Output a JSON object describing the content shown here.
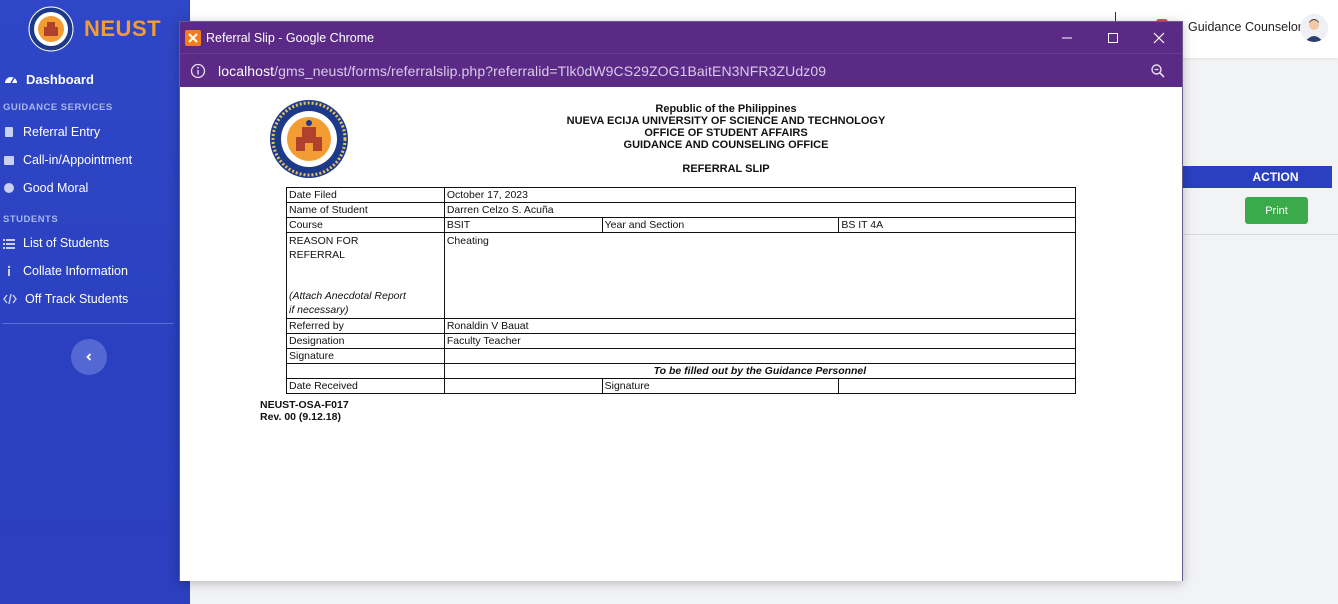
{
  "sidebar": {
    "brand": "NEUST",
    "dashboard": "Dashboard",
    "sections": [
      {
        "title": "GUIDANCE SERVICES",
        "items": [
          "Referral Entry",
          "Call-in/Appointment",
          "Good Moral"
        ]
      },
      {
        "title": "STUDENTS",
        "items": [
          "List of Students",
          "Collate Information",
          "Off Track Students"
        ]
      }
    ]
  },
  "topbar": {
    "user": "Guidance Counselor"
  },
  "table_bg": {
    "action_header": "ACTION",
    "print_label": "Print"
  },
  "browser": {
    "title": "Referral Slip - Google Chrome",
    "url_host": "localhost",
    "url_rest": "/gms_neust/forms/referralslip.php?referralid=Tlk0dW9CS29ZOG1BaitEN3NFR3ZUdz09"
  },
  "document": {
    "header_lines": [
      "Republic of the Philippines",
      "NUEVA ECIJA UNIVERSITY OF SCIENCE AND TECHNOLOGY",
      "OFFICE OF STUDENT AFFAIRS",
      "GUIDANCE AND COUNSELING OFFICE"
    ],
    "slip_title": "REFERRAL SLIP",
    "labels": {
      "date_filed": "Date Filed",
      "name": "Name of Student",
      "course": "Course",
      "year_section": "Year and Section",
      "reason_1": "REASON FOR",
      "reason_2": "REFERRAL",
      "attach_1": "(Attach Anecdotal Report",
      "attach_2": "if necessary)",
      "referred_by": "Referred by",
      "designation": "Designation",
      "signature": "Signature",
      "filled_by": "To be filled out by the Guidance Personnel",
      "date_received": "Date Received",
      "signature2": "Signature"
    },
    "values": {
      "date_filed": "October 17, 2023",
      "name": "Darren Celzo S. Acuña",
      "course": "BSIT",
      "year_section": "BS IT 4A",
      "reason": "Cheating",
      "referred_by": "Ronaldin V Bauat",
      "designation": "Faculty Teacher"
    },
    "form_code": "NEUST-OSA-F017",
    "revision": "Rev. 00 (9.12.18)"
  },
  "colors": {
    "sidebar": "#2f47c6",
    "brand": "#f39c34",
    "chrome_frame": "#5b2a86",
    "print": "#3aaa4a"
  }
}
